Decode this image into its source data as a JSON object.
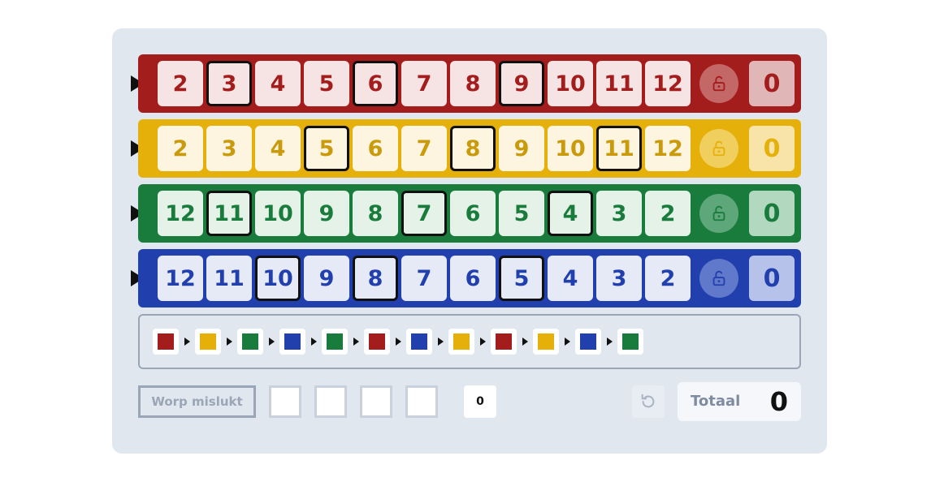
{
  "rows": [
    {
      "color": "red",
      "bg": "#a31d1d",
      "cell_bg": "#f6e3e3",
      "text": "#a31d1d",
      "lock_bg": "#c36767",
      "total_bg": "#e1b6b6",
      "numbers": [
        "2",
        "3",
        "4",
        "5",
        "6",
        "7",
        "8",
        "9",
        "10",
        "11",
        "12"
      ],
      "marked": [
        false,
        true,
        false,
        false,
        true,
        false,
        false,
        true,
        false,
        false,
        false
      ],
      "total": "0"
    },
    {
      "color": "yellow",
      "bg": "#e6b00b",
      "cell_bg": "#fdf5df",
      "text": "#c99a0b",
      "lock_bg": "#f1cf5e",
      "total_bg": "#f8e4a8",
      "numbers": [
        "2",
        "3",
        "4",
        "5",
        "6",
        "7",
        "8",
        "9",
        "10",
        "11",
        "12"
      ],
      "marked": [
        false,
        false,
        false,
        true,
        false,
        false,
        true,
        false,
        false,
        true,
        false
      ],
      "total": "0"
    },
    {
      "color": "green",
      "bg": "#1a7c3c",
      "cell_bg": "#e4f2e7",
      "text": "#1a7c3c",
      "lock_bg": "#5ea77b",
      "total_bg": "#b2d9bf",
      "numbers": [
        "12",
        "11",
        "10",
        "9",
        "8",
        "7",
        "6",
        "5",
        "4",
        "3",
        "2"
      ],
      "marked": [
        false,
        true,
        false,
        false,
        false,
        true,
        false,
        false,
        true,
        false,
        false
      ],
      "total": "0"
    },
    {
      "color": "blue",
      "bg": "#2240ad",
      "cell_bg": "#e6eaf7",
      "text": "#2240ad",
      "lock_bg": "#6079cb",
      "total_bg": "#b6c2e9",
      "numbers": [
        "12",
        "11",
        "10",
        "9",
        "8",
        "7",
        "6",
        "5",
        "4",
        "3",
        "2"
      ],
      "marked": [
        false,
        false,
        true,
        false,
        true,
        false,
        false,
        true,
        false,
        false,
        false
      ],
      "total": "0"
    }
  ],
  "sequence": [
    "#a31d1d",
    "#e6b00b",
    "#1a7c3c",
    "#2240ad",
    "#1a7c3c",
    "#a31d1d",
    "#2240ad",
    "#e6b00b",
    "#a31d1d",
    "#e6b00b",
    "#2240ad",
    "#1a7c3c"
  ],
  "controls": {
    "fail_label": "Worp mislukt",
    "fail_count": "0",
    "total_label": "Totaal",
    "total_value": "0"
  },
  "icons": {
    "lock": "unlocked-padlock-icon",
    "undo": "undo-icon",
    "arrow": "triangle-right-icon"
  }
}
